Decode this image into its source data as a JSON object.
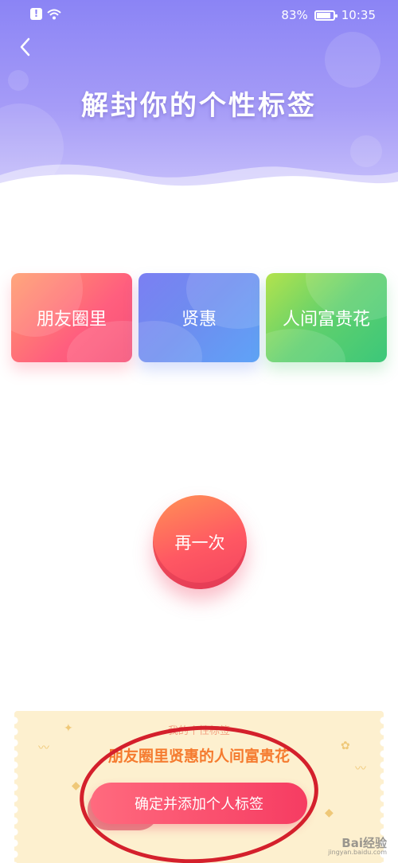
{
  "status_bar": {
    "battery": "83%",
    "time": "10:35"
  },
  "header": {
    "title": "解封你的个性标签"
  },
  "tags": [
    {
      "label": "朋友圈里"
    },
    {
      "label": "贤惠"
    },
    {
      "label": "人间富贵花"
    }
  ],
  "retry_button": {
    "label": "再一次"
  },
  "result_ticket": {
    "caption": "我的个性标签",
    "result": "朋友圈里贤惠的人间富贵花",
    "confirm_label": "确定并添加个人标签"
  },
  "watermark": {
    "brand": "Bai经验",
    "url": "jingyan.baidu.com"
  },
  "colors": {
    "header_top": "#8b84f5",
    "card_1": "#ff5f7e",
    "card_2": "#6d8ef0",
    "card_3": "#5fd06d",
    "accent": "#f63c62",
    "result_text": "#f57b2f",
    "highlight": "#d4202c"
  },
  "icons": [
    "alert-icon",
    "wifi-icon",
    "battery-icon",
    "back-arrow-icon"
  ]
}
